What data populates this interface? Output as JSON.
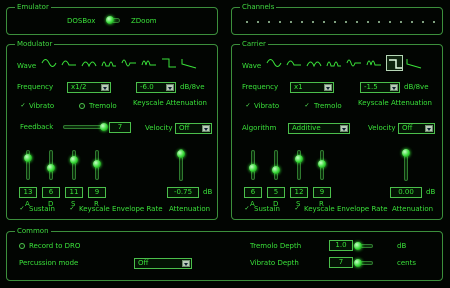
{
  "emulator": {
    "title": "Emulator",
    "option_left": "DOSBox",
    "option_right": "ZDoom"
  },
  "channels": {
    "title": "Channels"
  },
  "modulator": {
    "title": "Modulator",
    "wave_label": "Wave",
    "frequency_label": "Frequency",
    "frequency_value": "x1/2",
    "keyscale_value": "-6.0",
    "keyscale_unit": "dB/8ve",
    "vibrato_label": "Vibrato",
    "tremolo_label": "Tremolo",
    "keyscale_attenuation_label": "Keyscale Attenuation",
    "feedback_label": "Feedback",
    "feedback_value": "7",
    "velocity_label": "Velocity",
    "velocity_value": "Off",
    "adsr": [
      {
        "label": "A",
        "value": "13",
        "level": 0.85
      },
      {
        "label": "D",
        "value": "6",
        "level": 0.4
      },
      {
        "label": "S",
        "value": "11",
        "level": 0.73
      },
      {
        "label": "R",
        "value": "9",
        "level": 0.6
      }
    ],
    "attenuation_value": "-0.75",
    "attenuation_unit": "dB",
    "attenuation_level": 0.95,
    "sustain_label": "Sustain",
    "keyscale_env_label": "Keyscale Envelope Rate",
    "attenuation_label": "Attenuation"
  },
  "carrier": {
    "title": "Carrier",
    "wave_label": "Wave",
    "frequency_label": "Frequency",
    "frequency_value": "x1",
    "keyscale_value": "-1.5",
    "keyscale_unit": "dB/8ve",
    "vibrato_label": "Vibrato",
    "tremolo_label": "Tremolo",
    "keyscale_attenuation_label": "Keyscale Attenuation",
    "algorithm_label": "Algorithm",
    "algorithm_value": "Additive",
    "velocity_label": "Velocity",
    "velocity_value": "Off",
    "adsr": [
      {
        "label": "A",
        "value": "6",
        "level": 0.4
      },
      {
        "label": "D",
        "value": "5",
        "level": 0.33
      },
      {
        "label": "S",
        "value": "12",
        "level": 0.8
      },
      {
        "label": "R",
        "value": "9",
        "level": 0.6
      }
    ],
    "attenuation_value": "0.00",
    "attenuation_unit": "dB",
    "attenuation_level": 1.0,
    "sustain_label": "Sustain",
    "keyscale_env_label": "Keyscale Envelope Rate",
    "attenuation_label": "Attenuation"
  },
  "common": {
    "title": "Common",
    "record_label": "Record to DRO",
    "percussion_label": "Percussion mode",
    "percussion_value": "Off",
    "tremolo_depth_label": "Tremolo Depth",
    "tremolo_depth_value": "1.0",
    "tremolo_depth_unit": "dB",
    "vibrato_depth_label": "Vibrato Depth",
    "vibrato_depth_value": "7",
    "vibrato_depth_unit": "cents"
  }
}
